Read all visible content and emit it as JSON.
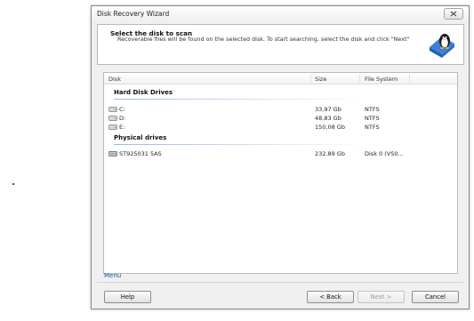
{
  "window": {
    "title": "Disk Recovery Wizard",
    "close_icon": "close-icon"
  },
  "header": {
    "title": "Select the disk to scan",
    "description": "Recoverable files will be found on the selected disk. To start searching, select the disk and click \"Next\"",
    "icon": "disk-with-penguin-icon"
  },
  "table": {
    "columns": {
      "disk": "Disk",
      "size": "Size",
      "file_system": "File System"
    },
    "groups": [
      {
        "title": "Hard Disk Drives",
        "rows": [
          {
            "name": "C:",
            "size": "33,97 Gb",
            "fs": "NTFS",
            "icon": "hard-drive-icon"
          },
          {
            "name": "D:",
            "size": "48,83 Gb",
            "fs": "NTFS",
            "icon": "hard-drive-icon"
          },
          {
            "name": "E:",
            "size": "150,08 Gb",
            "fs": "NTFS",
            "icon": "hard-drive-icon"
          }
        ]
      },
      {
        "title": "Physical drives",
        "rows": [
          {
            "name": "ST925031 5AS",
            "size": "232,89 Gb",
            "fs": "Disk 0 (VS0...",
            "icon": "physical-drive-icon"
          }
        ]
      }
    ]
  },
  "menu_link": "Menu",
  "buttons": {
    "help": "Help",
    "back": "< Back",
    "next": "Next >",
    "cancel": "Cancel"
  },
  "colors": {
    "link": "#1a4fb0",
    "group_line": "#9cb8e0",
    "disabled_text": "#9a9a9a"
  }
}
